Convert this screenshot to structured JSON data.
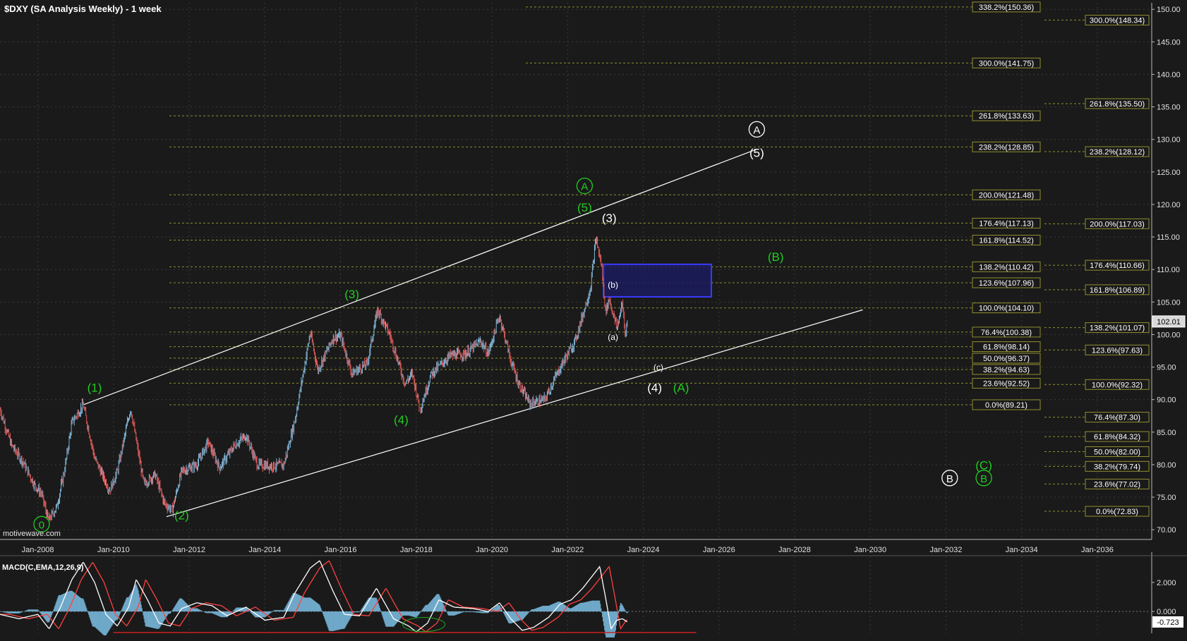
{
  "chart_data": [
    {
      "type": "line",
      "title": "$DXY (SA Analysis Weekly) - 1 week",
      "watermark": "motivewave.com",
      "xlabel": "",
      "ylabel": "",
      "x_ticks": [
        "Jan-2008",
        "Jan-2010",
        "Jan-2012",
        "Jan-2014",
        "Jan-2016",
        "Jan-2018",
        "Jan-2020",
        "Jan-2022",
        "Jan-2024",
        "Jan-2026",
        "Jan-2028",
        "Jan-2030",
        "Jan-2032",
        "Jan-2034",
        "Jan-2036"
      ],
      "xlim": [
        2007.0,
        2037.4
      ],
      "y_ticks": [
        "70.00",
        "75.00",
        "80.00",
        "85.00",
        "90.00",
        "95.00",
        "100.00",
        "105.00",
        "110.00",
        "115.00",
        "120.00",
        "125.00",
        "130.00",
        "135.00",
        "140.00",
        "145.00",
        "150.00"
      ],
      "ylim": [
        68.5,
        151
      ],
      "last_price": "102.01",
      "colors": {
        "background": "#1a1a1a",
        "grid": "#3a3a3a",
        "fib": "#8f8f32",
        "up_candle": "#7fb3d5",
        "down_candle": "#e05a5a",
        "wave_green": "#22cc22",
        "wave_white": "#ffffff",
        "target_box": "#1c1c5e"
      },
      "series": [
        {
          "values": [
            [
              2007.0,
              88.5
            ],
            [
              2007.3,
              83.0
            ],
            [
              2007.6,
              80.5
            ],
            [
              2007.9,
              77.0
            ],
            [
              2008.1,
              75.5
            ],
            [
              2008.28,
              71.4
            ],
            [
              2008.5,
              73.5
            ],
            [
              2008.7,
              79.0
            ],
            [
              2008.9,
              86.5
            ],
            [
              2009.2,
              89.2
            ],
            [
              2009.5,
              81.0
            ],
            [
              2009.9,
              76.0
            ],
            [
              2010.1,
              79.0
            ],
            [
              2010.45,
              88.7
            ],
            [
              2010.8,
              77.0
            ],
            [
              2011.1,
              78.5
            ],
            [
              2011.35,
              74.0
            ],
            [
              2011.55,
              73.0
            ],
            [
              2011.8,
              79.0
            ],
            [
              2012.2,
              80.0
            ],
            [
              2012.5,
              83.5
            ],
            [
              2012.8,
              79.5
            ],
            [
              2013.2,
              83.0
            ],
            [
              2013.5,
              84.5
            ],
            [
              2013.8,
              80.0
            ],
            [
              2014.2,
              79.8
            ],
            [
              2014.5,
              80.0
            ],
            [
              2014.8,
              87.0
            ],
            [
              2015.2,
              100.3
            ],
            [
              2015.4,
              94.5
            ],
            [
              2015.8,
              99.5
            ],
            [
              2016.0,
              99.8
            ],
            [
              2016.3,
              94.0
            ],
            [
              2016.7,
              95.5
            ],
            [
              2016.98,
              103.8
            ],
            [
              2017.3,
              100.0
            ],
            [
              2017.7,
              92.5
            ],
            [
              2017.9,
              94.0
            ],
            [
              2018.1,
              88.5
            ],
            [
              2018.4,
              94.0
            ],
            [
              2018.9,
              96.8
            ],
            [
              2019.3,
              97.0
            ],
            [
              2019.7,
              99.0
            ],
            [
              2019.9,
              97.0
            ],
            [
              2020.2,
              102.9
            ],
            [
              2020.5,
              96.0
            ],
            [
              2020.7,
              92.5
            ],
            [
              2021.0,
              89.4
            ],
            [
              2021.4,
              90.0
            ],
            [
              2021.6,
              92.5
            ],
            [
              2021.9,
              96.0
            ],
            [
              2022.2,
              99.0
            ],
            [
              2022.45,
              104.0
            ],
            [
              2022.6,
              107.0
            ],
            [
              2022.75,
              114.8
            ],
            [
              2022.9,
              110.5
            ],
            [
              2023.0,
              103.5
            ],
            [
              2023.1,
              105.5
            ],
            [
              2023.3,
              101.0
            ],
            [
              2023.45,
              104.8
            ],
            [
              2023.52,
              100.2
            ],
            [
              2023.58,
              102.0
            ]
          ]
        }
      ],
      "macd": {
        "label": "MACD(C,EMA,12,26,9)",
        "ticks": [
          "2.000",
          "0.000"
        ],
        "ylim": [
          -1.5,
          3.6
        ],
        "last_value": "-0.723",
        "points": [
          [
            2007.0,
            -0.2
          ],
          [
            2007.5,
            -0.5
          ],
          [
            2008.0,
            -0.2
          ],
          [
            2008.3,
            -1.2
          ],
          [
            2008.6,
            0.3
          ],
          [
            2008.9,
            2.2
          ],
          [
            2009.2,
            3.4
          ],
          [
            2009.5,
            2.0
          ],
          [
            2009.8,
            -0.2
          ],
          [
            2010.1,
            -1.0
          ],
          [
            2010.4,
            0.3
          ],
          [
            2010.6,
            2.2
          ],
          [
            2010.9,
            0.8
          ],
          [
            2011.2,
            -0.8
          ],
          [
            2011.5,
            -1.0
          ],
          [
            2011.8,
            0.2
          ],
          [
            2012.2,
            0.6
          ],
          [
            2012.6,
            0.4
          ],
          [
            2013.0,
            -0.3
          ],
          [
            2013.5,
            0.3
          ],
          [
            2014.0,
            -0.6
          ],
          [
            2014.5,
            -0.4
          ],
          [
            2014.8,
            1.3
          ],
          [
            2015.2,
            3.0
          ],
          [
            2015.45,
            3.5
          ],
          [
            2015.8,
            1.4
          ],
          [
            2016.1,
            -0.2
          ],
          [
            2016.5,
            -0.3
          ],
          [
            2016.95,
            1.6
          ],
          [
            2017.4,
            -0.5
          ],
          [
            2017.8,
            -1.0
          ],
          [
            2018.0,
            -1.4
          ],
          [
            2018.3,
            -0.8
          ],
          [
            2018.6,
            0.8
          ],
          [
            2019.0,
            0.3
          ],
          [
            2019.5,
            0.2
          ],
          [
            2019.9,
            0.0
          ],
          [
            2020.2,
            0.6
          ],
          [
            2020.5,
            -0.5
          ],
          [
            2020.8,
            -1.3
          ],
          [
            2021.1,
            -1.1
          ],
          [
            2021.5,
            -0.4
          ],
          [
            2021.8,
            0.5
          ],
          [
            2022.1,
            0.8
          ],
          [
            2022.4,
            1.6
          ],
          [
            2022.7,
            2.6
          ],
          [
            2022.85,
            3.1
          ],
          [
            2023.0,
            1.0
          ],
          [
            2023.15,
            -1.2
          ],
          [
            2023.3,
            -0.6
          ],
          [
            2023.45,
            -0.5
          ],
          [
            2023.58,
            -0.723
          ]
        ]
      },
      "annotations": {
        "left_fibs": [
          {
            "label": "338.2%(150.36)",
            "value": 150.36
          },
          {
            "label": "300.0%(141.75)",
            "value": 141.75
          },
          {
            "label": "261.8%(133.63)",
            "value": 133.63
          },
          {
            "label": "238.2%(128.85)",
            "value": 128.85
          },
          {
            "label": "200.0%(121.48)",
            "value": 121.48
          },
          {
            "label": "176.4%(117.13)",
            "value": 117.13
          },
          {
            "label": "161.8%(114.52)",
            "value": 114.52
          },
          {
            "label": "138.2%(110.42)",
            "value": 110.42
          },
          {
            "label": "123.6%(107.96)",
            "value": 107.96
          },
          {
            "label": "100.0%(104.10)",
            "value": 104.1
          },
          {
            "label": "76.4%(100.38)",
            "value": 100.38
          },
          {
            "label": "61.8%(98.14)",
            "value": 98.14
          },
          {
            "label": "50.0%(96.37)",
            "value": 96.37
          },
          {
            "label": "38.2%(94.63)",
            "value": 94.63
          },
          {
            "label": "23.6%(92.52)",
            "value": 92.52
          },
          {
            "label": "0.0%(89.21)",
            "value": 89.21
          }
        ],
        "right_fibs": [
          {
            "label": "300.0%(148.34)",
            "value": 148.34
          },
          {
            "label": "261.8%(135.50)",
            "value": 135.5
          },
          {
            "label": "238.2%(128.12)",
            "value": 128.12
          },
          {
            "label": "200.0%(117.03)",
            "value": 117.03
          },
          {
            "label": "176.4%(110.66)",
            "value": 110.66
          },
          {
            "label": "161.8%(106.89)",
            "value": 106.89
          },
          {
            "label": "138.2%(101.07)",
            "value": 101.07
          },
          {
            "label": "123.6%(97.63)",
            "value": 97.63
          },
          {
            "label": "100.0%(92.32)",
            "value": 92.32
          },
          {
            "label": "76.4%(87.30)",
            "value": 87.3
          },
          {
            "label": "61.8%(84.32)",
            "value": 84.32
          },
          {
            "label": "50.0%(82.00)",
            "value": 82.0
          },
          {
            "label": "38.2%(79.74)",
            "value": 79.74
          },
          {
            "label": "23.6%(77.02)",
            "value": 77.02
          },
          {
            "label": "0.0%(72.83)",
            "value": 72.83
          }
        ],
        "wave_labels": [
          {
            "text": "0",
            "x": 2008.1,
            "y": 70.2,
            "color": "green",
            "circled": true
          },
          {
            "text": "(1)",
            "x": 2009.5,
            "y": 91.2,
            "color": "green"
          },
          {
            "text": "(2)",
            "x": 2011.8,
            "y": 71.6,
            "color": "green"
          },
          {
            "text": "(3)",
            "x": 2016.3,
            "y": 105.6,
            "color": "green"
          },
          {
            "text": "(4)",
            "x": 2017.6,
            "y": 86.3,
            "color": "green"
          },
          {
            "text": "A",
            "x": 2022.45,
            "y": 122.2,
            "color": "green",
            "circled": true
          },
          {
            "text": "(5)",
            "x": 2022.45,
            "y": 118.9,
            "color": "green"
          },
          {
            "text": "(3)",
            "x": 2023.1,
            "y": 117.3,
            "color": "white"
          },
          {
            "text": "A",
            "x": 2027.0,
            "y": 130.9,
            "color": "white",
            "circled": true
          },
          {
            "text": "(5)",
            "x": 2027.0,
            "y": 127.3,
            "color": "white"
          },
          {
            "text": "(B)",
            "x": 2027.5,
            "y": 111.3,
            "color": "green"
          },
          {
            "text": "(b)",
            "x": 2023.2,
            "y": 107.2,
            "color": "white",
            "small": true
          },
          {
            "text": "(a)",
            "x": 2023.2,
            "y": 99.2,
            "color": "white",
            "small": true
          },
          {
            "text": "(c)",
            "x": 2024.4,
            "y": 94.5,
            "color": "white",
            "small": true
          },
          {
            "text": "(4)",
            "x": 2024.3,
            "y": 91.2,
            "color": "white"
          },
          {
            "text": "(A)",
            "x": 2025.0,
            "y": 91.2,
            "color": "green"
          },
          {
            "text": "(C)",
            "x": 2033.0,
            "y": 79.3,
            "color": "green"
          },
          {
            "text": "B",
            "x": 2032.1,
            "y": 77.3,
            "color": "white",
            "circled": true
          },
          {
            "text": "B",
            "x": 2033.0,
            "y": 77.3,
            "color": "green",
            "circled": true
          }
        ],
        "channel": [
          {
            "from": [
              2009.2,
              89.2
            ],
            "to": [
              2027.0,
              128.5
            ]
          },
          {
            "from": [
              2011.4,
              72.0
            ],
            "to": [
              2029.8,
              103.8
            ]
          }
        ],
        "target_box": {
          "x0": 2022.95,
          "x1": 2025.8,
          "y0": 105.8,
          "y1": 110.8
        }
      }
    }
  ]
}
